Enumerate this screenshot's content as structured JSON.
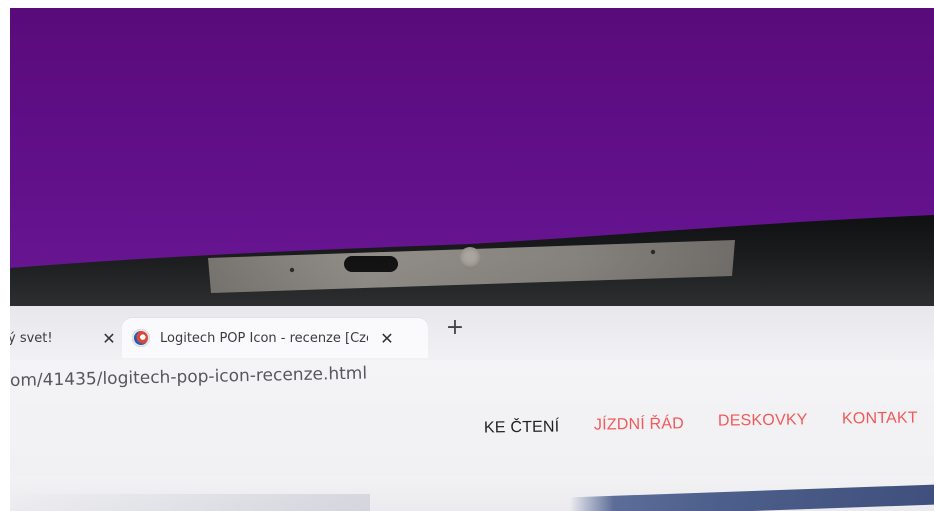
{
  "colors": {
    "screen_purple": "#5c0c7e",
    "screen_purple_bright": "#6b1794",
    "bezel": "#191a1b",
    "camera_strip": "#8d8a86",
    "browser_bg": "#f1f1f4",
    "nav_red": "#f05a5c",
    "nav_dark": "#222222"
  },
  "browser": {
    "tabs": [
      {
        "title": "ý svet!",
        "close_icon": "close-icon",
        "state": "inactive"
      },
      {
        "title": "Logitech POP Icon - recenze [Cze",
        "favicon": "globe-favicon",
        "close_icon": "close-icon",
        "state": "active"
      }
    ],
    "new_tab_icon": "plus-icon",
    "address": "om/41435/logitech-pop-icon-recenze.html"
  },
  "site_nav": {
    "items": [
      {
        "label": "KE ČTENÍ",
        "color": "#222222"
      },
      {
        "label": "JÍZDNÍ ŘÁD",
        "color": "#f05a5c"
      },
      {
        "label": "DESKOVKY",
        "color": "#f05a5c"
      },
      {
        "label": "KONTAKT",
        "color": "#f05a5c"
      }
    ]
  }
}
